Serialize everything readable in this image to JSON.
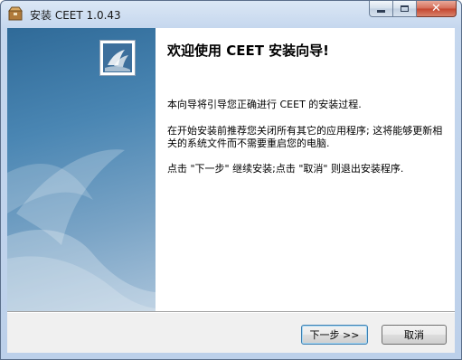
{
  "window": {
    "title": "安装 CEET 1.0.43",
    "controls": {
      "minimize": "minimize",
      "maximize": "maximize",
      "close": "close"
    }
  },
  "wizard": {
    "heading": "欢迎使用 CEET 安装向导!",
    "paragraphs": [
      "本向导将引导您正确进行 CEET 的安装过程.",
      "在开始安装前推荐您关闭所有其它的应用程序; 这将能够更新相关的系统文件而不需要重启您的电脑.",
      "点击 \"下一步\" 继续安装;点击 \"取消\" 则退出安装程序."
    ]
  },
  "buttons": {
    "next": "下一步 >>",
    "cancel": "取消"
  },
  "colors": {
    "side_panel": "#4a86b3",
    "accent": "#3c7fb1",
    "close_button": "#c4452e"
  },
  "icons": {
    "app": "installer-box-icon",
    "logo": "ceet-sail-logo-icon"
  }
}
